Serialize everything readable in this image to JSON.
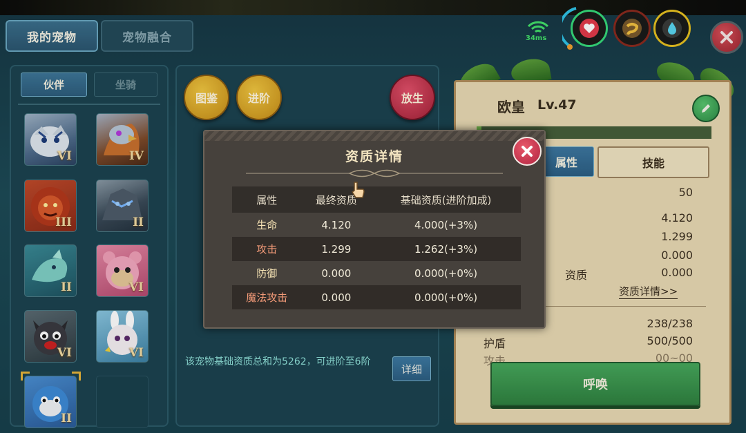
{
  "tabs": [
    {
      "label": "我的宠物",
      "active": true
    },
    {
      "label": "宠物融合",
      "active": false
    }
  ],
  "subtabs": [
    {
      "label": "伙伴",
      "active": true
    },
    {
      "label": "坐骑",
      "active": false
    }
  ],
  "pet_grid": [
    {
      "name": "white-tiger",
      "grade": "VI"
    },
    {
      "name": "griffin",
      "grade": "IV"
    },
    {
      "name": "red-lion",
      "grade": "III"
    },
    {
      "name": "stone-dragon",
      "grade": "II"
    },
    {
      "name": "sea-dragon",
      "grade": "II"
    },
    {
      "name": "pink-bear",
      "grade": "VI"
    },
    {
      "name": "black-dog",
      "grade": "VI"
    },
    {
      "name": "white-rabbit",
      "grade": "VI"
    },
    {
      "name": "blue-seal",
      "grade": "II",
      "selected": true
    },
    {
      "name": "empty",
      "grade": ""
    }
  ],
  "actions": {
    "codex_label": "图鉴",
    "advance_label": "进阶",
    "release_label": "放生"
  },
  "advance_info": {
    "text": "该宠物基础资质总和为5262，可进阶至6阶",
    "detail_button": "详细"
  },
  "hud": {
    "ping": "34ms",
    "icons": [
      "wifi-icon",
      "heart-icon",
      "food-icon",
      "water-icon",
      "close-icon"
    ]
  },
  "pet_card": {
    "name": "欧皇",
    "level": "Lv.47",
    "tab_attr": "属性",
    "tab_skill": "技能",
    "rows": [
      {
        "label": "",
        "value": "50"
      },
      {
        "label": "",
        "value": "4.120"
      },
      {
        "label": "",
        "value": "1.299"
      },
      {
        "label": "",
        "value": "0.000"
      },
      {
        "label": "资质",
        "value": "0.000"
      }
    ],
    "detail_link": "资质详情>>",
    "stats": [
      {
        "label": "",
        "value": "238/238"
      },
      {
        "label": "护盾",
        "value": "500/500"
      },
      {
        "label": "攻击",
        "value": "00~00"
      }
    ],
    "summon_label": "呼唤"
  },
  "dialog": {
    "title": "资质详情",
    "columns": [
      "属性",
      "最终资质",
      "基础资质(进阶加成)"
    ],
    "rows": [
      {
        "attr": "生命",
        "final": "4.120",
        "base": "4.000(+3%)"
      },
      {
        "attr": "攻击",
        "final": "1.299",
        "base": "1.262(+3%)"
      },
      {
        "attr": "防御",
        "final": "0.000",
        "base": "0.000(+0%)"
      },
      {
        "attr": "魔法攻击",
        "final": "0.000",
        "base": "0.000(+0%)"
      }
    ]
  },
  "colors": {
    "accent_blue": "#3b6f8c",
    "gold_button": "#e0b030",
    "red_button": "#c83a52",
    "summon_green": "#3f9a52",
    "dialog_bg": "#46413c"
  }
}
